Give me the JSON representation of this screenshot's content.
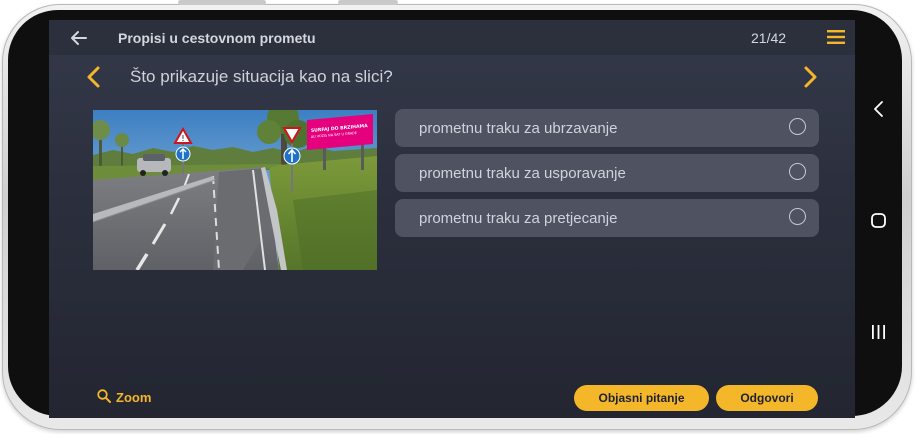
{
  "header": {
    "title": "Propisi u cestovnom prometu",
    "counter": "21/42"
  },
  "question": {
    "text": "Što prikazuje situacija kao na slici?"
  },
  "scene": {
    "billboard_line1": "SURFAJ DO BRZIHAMA",
    "billboard_line2": "AU VOZIS NA ŠAT U GRADE"
  },
  "answers": [
    {
      "label": "prometnu traku za ubrzavanje",
      "selected": false
    },
    {
      "label": "prometnu traku za usporavanje",
      "selected": false
    },
    {
      "label": "prometnu traku za pretjecanje",
      "selected": false
    }
  ],
  "footer": {
    "zoom_label": "Zoom",
    "explain_label": "Objasni pitanje",
    "answer_label": "Odgovori"
  },
  "colors": {
    "accent": "#f3b729",
    "option_bg": "#4e5261",
    "screen_bg": "#2c303e",
    "billboard": "#e5007d"
  },
  "icons": [
    "back-arrow-icon",
    "hamburger-menu-icon",
    "chevron-left-icon",
    "chevron-right-icon",
    "search-icon",
    "android-back-icon",
    "android-home-icon",
    "android-recents-icon"
  ]
}
